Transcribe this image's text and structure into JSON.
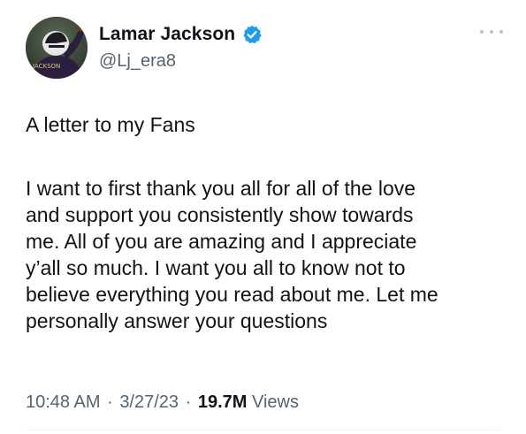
{
  "user": {
    "display_name": "Lamar Jackson",
    "handle": "@Lj_era8",
    "verified": true,
    "avatar_icon": "profile-photo",
    "jersey_text": "JACKSON"
  },
  "colors": {
    "verified_blue": "#1d9bf0",
    "secondary_text": "#536471",
    "primary_text": "#0f1419"
  },
  "more_icon": "more-dots-icon",
  "tweet": {
    "title_line": "A letter to my Fans",
    "body_lines": [
      "I want to first thank you all for all of the love",
      "and support you consistently show towards",
      "me. All of you are amazing and I appreciate",
      "y’all so much. I want you all to know not to",
      "believe everything you read about me. Let me",
      "personally answer your questions"
    ]
  },
  "meta": {
    "time": "10:48 AM",
    "date": "3/27/23",
    "separator": "·",
    "views_count": "19.7M",
    "views_label": "Views"
  }
}
